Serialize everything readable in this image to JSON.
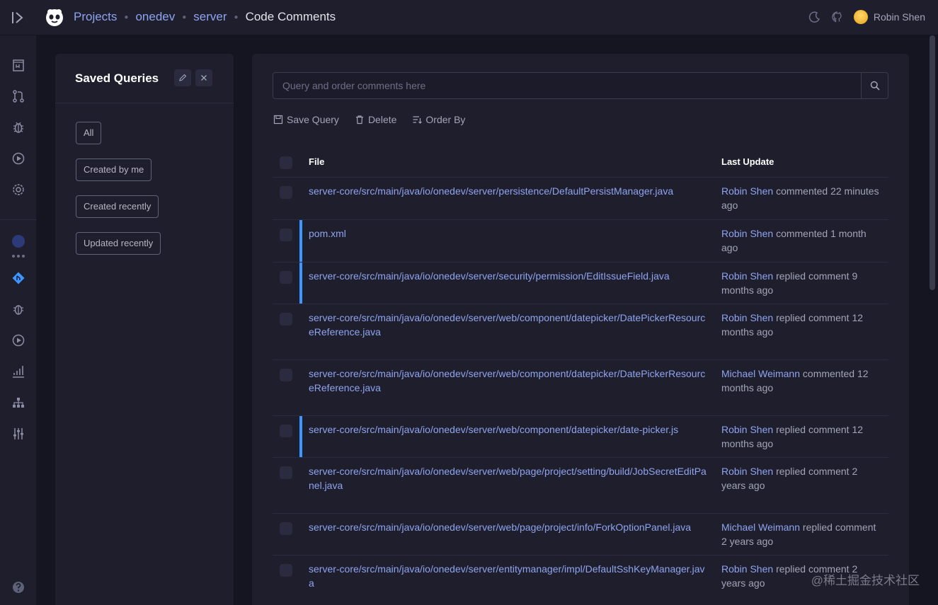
{
  "breadcrumbs": {
    "projects": "Projects",
    "project": "onedev",
    "subproject": "server",
    "current": "Code Comments"
  },
  "user": {
    "name": "Robin Shen"
  },
  "saved_queries": {
    "title": "Saved Queries",
    "items": [
      "All",
      "Created by me",
      "Created recently",
      "Updated recently"
    ]
  },
  "search": {
    "placeholder": "Query and order comments here",
    "value": ""
  },
  "actions": {
    "save": "Save Query",
    "delete": "Delete",
    "order": "Order By"
  },
  "table": {
    "headers": {
      "file": "File",
      "update": "Last Update"
    },
    "rows": [
      {
        "file": "server-core/src/main/java/io/onedev/server/persistence/DefaultPersistManager.java",
        "user": "Robin Shen",
        "action": "commented 22 minutes ago",
        "marked": false
      },
      {
        "file": "pom.xml",
        "user": "Robin Shen",
        "action": "commented 1 month ago",
        "marked": true
      },
      {
        "file": "server-core/src/main/java/io/onedev/server/security/permission/EditIssueField.java",
        "user": "Robin Shen",
        "action": "replied comment 9 months ago",
        "marked": true
      },
      {
        "file": "server-core/src/main/java/io/onedev/server/web/component/datepicker/DatePickerResourceReference.java",
        "user": "Robin Shen",
        "action": "replied comment 12 months ago",
        "marked": false
      },
      {
        "file": "server-core/src/main/java/io/onedev/server/web/component/datepicker/DatePickerResourceReference.java",
        "user": "Michael Weimann",
        "action": "commented 12 months ago",
        "marked": false
      },
      {
        "file": "server-core/src/main/java/io/onedev/server/web/component/datepicker/date-picker.js",
        "user": "Robin Shen",
        "action": "replied comment 12 months ago",
        "marked": true
      },
      {
        "file": "server-core/src/main/java/io/onedev/server/web/page/project/setting/build/JobSecretEditPanel.java",
        "user": "Robin Shen",
        "action": "replied comment 2 years ago",
        "marked": false
      },
      {
        "file": "server-core/src/main/java/io/onedev/server/web/page/project/info/ForkOptionPanel.java",
        "user": "Michael Weimann",
        "action": "replied comment 2 years ago",
        "marked": false
      },
      {
        "file": "server-core/src/main/java/io/onedev/server/entitymanager/impl/DefaultSshKeyManager.java",
        "user": "Robin Shen",
        "action": "replied comment 2 years ago",
        "marked": false
      }
    ]
  },
  "watermark": "@稀土掘金技术社区",
  "colors": {
    "accent": "#3e97ff",
    "link": "#8fa4ef",
    "bg": "#1e1e2d",
    "content_bg": "#151521"
  }
}
